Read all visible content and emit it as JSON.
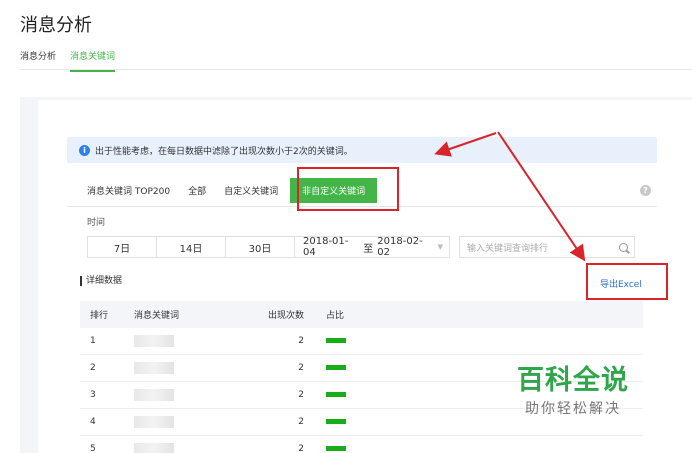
{
  "page": {
    "title": "消息分析"
  },
  "tabs": [
    {
      "label": "消息分析",
      "active": false
    },
    {
      "label": "消息关键词",
      "active": true
    }
  ],
  "notice": {
    "icon": "info-icon",
    "text": "出于性能考虑，在每日数据中滤除了出现次数小于2次的关键词。"
  },
  "keyword_tabs": [
    {
      "label": "消息关键词 TOP200",
      "active": false
    },
    {
      "label": "全部",
      "active": false
    },
    {
      "label": "自定义关键词",
      "active": false
    },
    {
      "label": "非自定义关键词",
      "active": true
    }
  ],
  "time": {
    "label": "时间",
    "ranges": [
      "7日",
      "14日",
      "30日"
    ],
    "date_from": "2018-01-04",
    "date_sep": "至",
    "date_to": "2018-02-02"
  },
  "search": {
    "placeholder": "输入关键词查询排行"
  },
  "detail": {
    "title": "详细数据",
    "export_label": "导出Excel"
  },
  "table": {
    "headers": [
      "排行",
      "消息关键词",
      "出现次数",
      "占比"
    ],
    "rows": [
      {
        "rank": "1",
        "keyword": "",
        "count": "2"
      },
      {
        "rank": "2",
        "keyword": "",
        "count": "2"
      },
      {
        "rank": "3",
        "keyword": "",
        "count": "2"
      },
      {
        "rank": "4",
        "keyword": "",
        "count": "2"
      },
      {
        "rank": "5",
        "keyword": "",
        "count": "2"
      }
    ]
  },
  "watermark": {
    "big": "百科全说",
    "small": "助你轻松解决"
  },
  "colors": {
    "accent": "#44b549",
    "annotation": "#d9242b",
    "link": "#2e6fd1"
  }
}
